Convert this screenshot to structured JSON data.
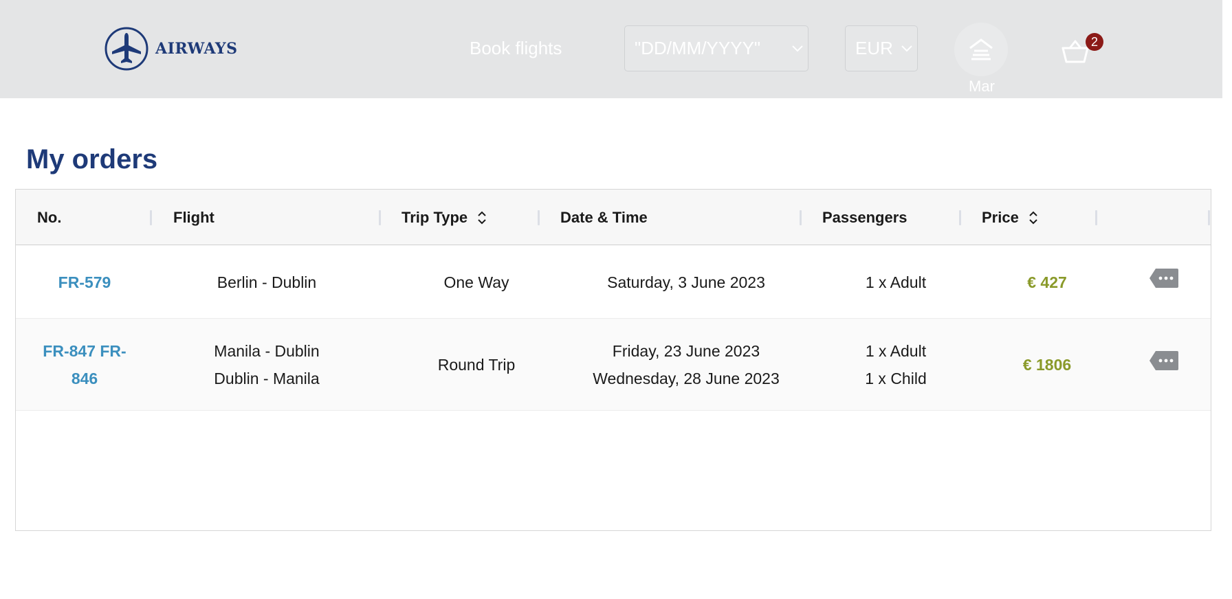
{
  "brand": {
    "name": "AIRWAYS",
    "logo_icon": "airplane-circle-icon",
    "color": "#1e3a78"
  },
  "nav": {
    "book_flights": "Book flights",
    "date_select": {
      "value": "\"DD/MM/YYYY\""
    },
    "currency_select": {
      "value": "EUR"
    },
    "user": {
      "name": "Mar",
      "icon": "user-icon"
    },
    "cart": {
      "count": "2",
      "icon": "basket-icon",
      "badge_color": "#8b1a17"
    }
  },
  "page": {
    "title": "My orders"
  },
  "table": {
    "columns": {
      "no": "No.",
      "flight": "Flight",
      "trip_type": "Trip Type",
      "date_time": "Date & Time",
      "passengers": "Passengers",
      "price": "Price"
    },
    "rows": [
      {
        "no": "FR-579",
        "flight": [
          "Berlin - Dublin"
        ],
        "trip_type": "One Way",
        "dates": [
          "Saturday, 3 June 2023"
        ],
        "passengers": [
          "1 x Adult"
        ],
        "price": "€ 427"
      },
      {
        "no": "FR-847 FR-846",
        "flight": [
          "Manila - Dublin",
          "Dublin - Manila"
        ],
        "trip_type": "Round Trip",
        "dates": [
          "Friday, 23 June 2023",
          "Wednesday, 28 June 2023"
        ],
        "passengers": [
          "1 x Adult",
          "1 x Child"
        ],
        "price": "€ 1806"
      }
    ]
  },
  "colors": {
    "link": "#3b8fbe",
    "price": "#8a9a2a",
    "header_bg": "#e4e5e6"
  }
}
